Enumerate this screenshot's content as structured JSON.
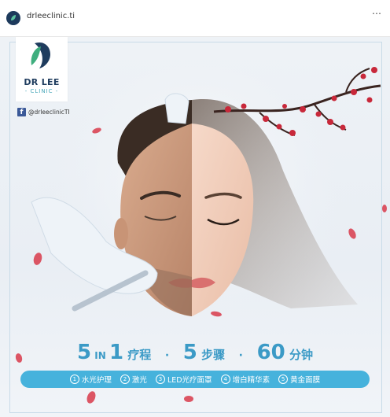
{
  "header": {
    "username": "drleeclinic.ti",
    "more_icon": "⋯"
  },
  "logo": {
    "name": "DR LEE",
    "sub": "- CLINIC -",
    "brand_color": "#1f3c5e",
    "accent_color": "#48a7b9"
  },
  "facebook": {
    "icon": "f",
    "handle": "@drleeclinicTI"
  },
  "tagline": {
    "part1_num_a": "5",
    "part1_in": " IN ",
    "part1_num_b": "1",
    "part1_cn": " 疗程",
    "sep1": "·",
    "part2_num": "5",
    "part2_cn": " 步骤",
    "sep2": "·",
    "part3_num": "60",
    "part3_cn": " 分钟",
    "color": "#3b9ac6"
  },
  "steps": [
    {
      "num": "1",
      "label": "水光护理"
    },
    {
      "num": "2",
      "label": "激光"
    },
    {
      "num": "3",
      "label": "LED光疗面罩"
    },
    {
      "num": "4",
      "label": "增白精华素"
    },
    {
      "num": "5",
      "label": "黄金面膜"
    }
  ],
  "steps_bar_color": "#46b2dc"
}
